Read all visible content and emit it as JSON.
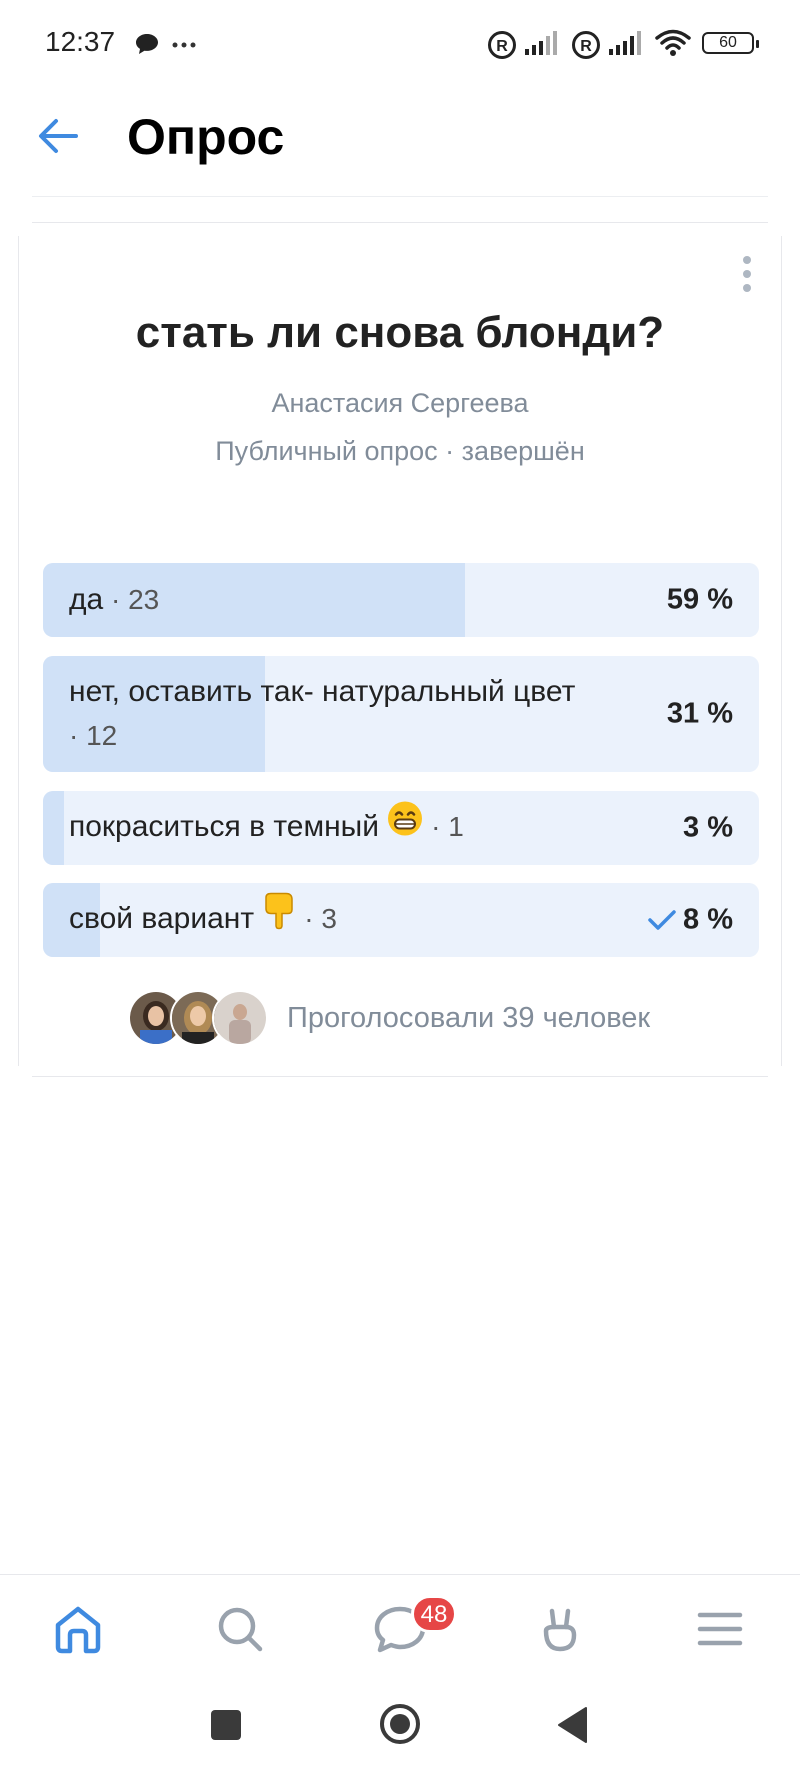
{
  "status_bar": {
    "time": "12:37",
    "battery": "60",
    "icons": [
      "message-icon",
      "more-dots-icon",
      "roaming-icon",
      "signal-icon",
      "roaming-icon",
      "signal-icon",
      "wifi-icon",
      "battery-icon"
    ]
  },
  "header": {
    "title": "Опрос",
    "back_icon": "arrow-left-icon"
  },
  "poll": {
    "question": "стать ли снова блонди?",
    "author": "Анастасия Сергеева",
    "meta": "Публичный опрос · завершён",
    "options": [
      {
        "text": "да",
        "count": " · 23",
        "percent": "59 %",
        "fraction": 0.59,
        "selected": false
      },
      {
        "text": "нет, оставить так- натуральный цвет",
        "count": " · 12",
        "percent": "31 %",
        "fraction": 0.31,
        "selected": false
      },
      {
        "text": "покраситься в темный",
        "emoji": "grinning-face-icon",
        "count": " · 1",
        "percent": "3 %",
        "fraction": 0.03,
        "selected": false
      },
      {
        "text": "свой вариант",
        "emoji": "pointing-down-icon",
        "count": " · 3",
        "percent": "8 %",
        "fraction": 0.08,
        "selected": true
      }
    ],
    "voters_text": "Проголосовали 39 человек"
  },
  "bottom_nav": {
    "items": [
      "home-icon",
      "search-icon",
      "messages-icon",
      "clips-icon",
      "menu-icon"
    ],
    "messages_badge": "48",
    "active": "home-icon"
  },
  "colors": {
    "accent": "#3f8ae0",
    "option_bg": "#ebf2fc",
    "option_fill": "#d0e1f7",
    "secondary_text": "#818c99",
    "badge": "#e64646"
  }
}
